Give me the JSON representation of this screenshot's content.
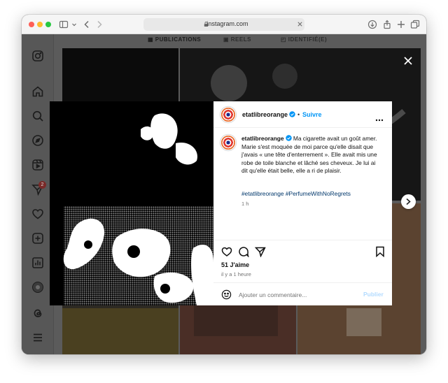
{
  "browser": {
    "url": "instagram.com",
    "icons": [
      "sidebar-icon",
      "chevron-down-icon",
      "back-icon",
      "forward-icon",
      "page-icon",
      "lock-icon",
      "clear-icon",
      "download-icon",
      "share-icon",
      "new-tab-icon",
      "tabs-overview-icon"
    ]
  },
  "profile_tabs": [
    {
      "label": "PUBLICATIONS",
      "icon": "grid-icon"
    },
    {
      "label": "REELS",
      "icon": "reels-icon"
    },
    {
      "label": "IDENTIFIÉ(E)",
      "icon": "tagged-icon"
    }
  ],
  "sidebar": {
    "icons": [
      "instagram-logo-icon",
      "home-icon",
      "search-icon",
      "explore-icon",
      "reels-icon",
      "messages-icon",
      "notifications-icon",
      "create-icon",
      "dashboard-icon",
      "profile-avatar",
      "threads-icon",
      "menu-icon"
    ],
    "messages_badge": "2"
  },
  "post": {
    "username": "etatlibreorange",
    "follow_label": "Suivre",
    "separator": "•",
    "caption_text": "Ma cigarette avait un goût amer. Marie s'est moquée de moi parce qu'elle disait que j'avais « une tête d'enterrement ». Elle avait mis une robe de toile blanche et lâché ses cheveux. Je lui ai dit qu'elle était belle, elle a ri de plaisir.",
    "hashtags": "#etatlibreorange #PerfumeWithNoRegrets",
    "caption_time": "1 h",
    "likes": "51 J'aime",
    "time_ago": "il y a 1 heure",
    "comment_placeholder": "Ajouter un commentaire...",
    "publish_label": "Publier"
  },
  "colors": {
    "link_blue": "#0095f6",
    "hashtag_blue": "#00376b",
    "overlay": "#5b5b5b",
    "publish_disabled": "#b3dbff"
  }
}
